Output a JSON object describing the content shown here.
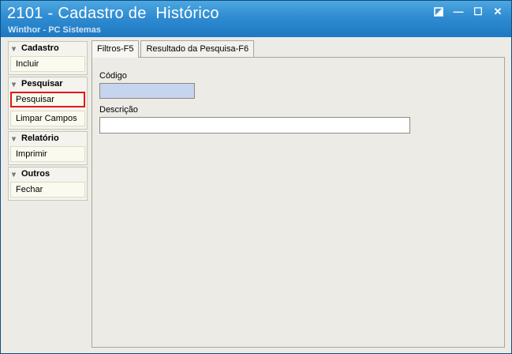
{
  "window": {
    "title": "2101 - Cadastro de  Histórico",
    "subtitle": "Winthor - PC Sistemas",
    "controls": {
      "restore_icon": "restore-icon",
      "minimize_glyph": "—",
      "maximize_glyph": "☐",
      "close_glyph": "✕"
    }
  },
  "sidebar": {
    "groups": [
      {
        "header": "Cadastro",
        "items": [
          "Incluir"
        ]
      },
      {
        "header": "Pesquisar",
        "items": [
          "Pesquisar",
          "Limpar Campos"
        ]
      },
      {
        "header": "Relatório",
        "items": [
          "Imprimir"
        ]
      },
      {
        "header": "Outros",
        "items": [
          "Fechar"
        ]
      }
    ],
    "highlighted_item": "Pesquisar",
    "highlight_color": "#e3171b"
  },
  "tabs": [
    {
      "label": "Filtros-F5",
      "active": true
    },
    {
      "label": "Resultado da Pesquisa-F6",
      "active": false
    }
  ],
  "form": {
    "codigo": {
      "label": "Código",
      "value": ""
    },
    "descricao": {
      "label": "Descrição",
      "value": ""
    }
  },
  "colors": {
    "titlebar": "#2f8cd1",
    "background": "#ecebe6",
    "codigo_field": "#c6d4ee"
  }
}
